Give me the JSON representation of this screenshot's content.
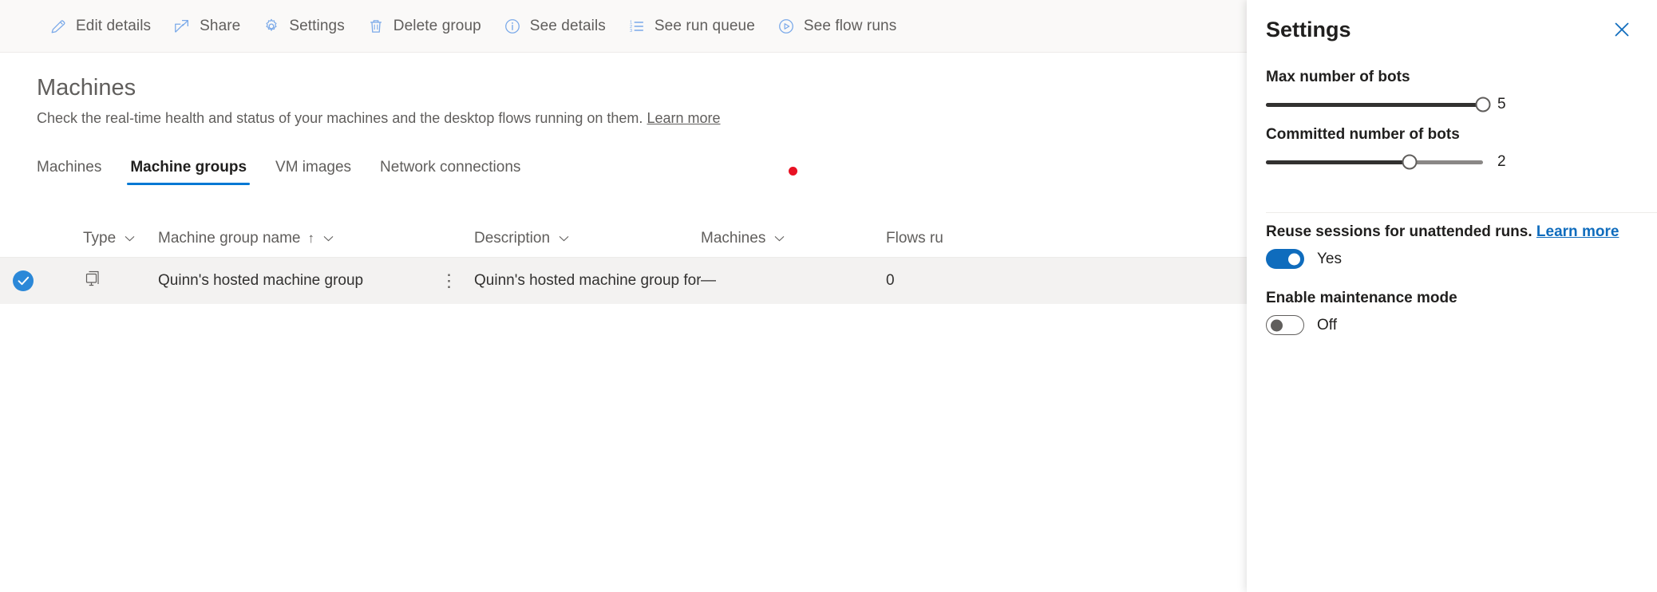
{
  "toolbar": {
    "items": [
      {
        "label": "Edit details",
        "icon": "pencil-icon"
      },
      {
        "label": "Share",
        "icon": "share-icon"
      },
      {
        "label": "Settings",
        "icon": "gear-icon"
      },
      {
        "label": "Delete group",
        "icon": "trash-icon"
      },
      {
        "label": "See details",
        "icon": "info-icon"
      },
      {
        "label": "See run queue",
        "icon": "numbered-list-icon"
      },
      {
        "label": "See flow runs",
        "icon": "play-circle-icon"
      }
    ]
  },
  "page": {
    "title": "Machines",
    "subtitle": "Check the real-time health and status of your machines and the desktop flows running on them.",
    "learn_more": "Learn more"
  },
  "tabs": [
    {
      "label": "Machines",
      "active": false
    },
    {
      "label": "Machine groups",
      "active": true
    },
    {
      "label": "VM images",
      "active": false
    },
    {
      "label": "Network connections",
      "active": false
    }
  ],
  "indicators": {
    "red_dot_color": "#e81123"
  },
  "table": {
    "columns": [
      {
        "label": "Type",
        "sorted": false
      },
      {
        "label": "Machine group name",
        "sorted": true,
        "sort_glyph": "↑"
      },
      {
        "label": "Description",
        "sorted": false
      },
      {
        "label": "Machines",
        "sorted": false
      },
      {
        "label": "Flows ru",
        "sorted": false
      }
    ],
    "rows": [
      {
        "selected": true,
        "type_icon": "machine-group-icon",
        "name": "Quinn's hosted machine group",
        "description": "Quinn's hosted machine group for Financ...",
        "machines": "—",
        "flows_running": "0",
        "overflow": "⋮"
      }
    ]
  },
  "settings_panel": {
    "title": "Settings",
    "close_label": "✕",
    "max_bots": {
      "label": "Max number of bots",
      "value": "5",
      "percent": 100
    },
    "committed_bots": {
      "label": "Committed number of bots",
      "value": "2",
      "percent": 66
    },
    "reuse_sessions": {
      "label": "Reuse sessions for unattended runs.",
      "link": "Learn more",
      "state": "Yes",
      "on": true
    },
    "maintenance_mode": {
      "label": "Enable maintenance mode",
      "state": "Off",
      "on": false
    },
    "accent": "#0f6cbd"
  }
}
